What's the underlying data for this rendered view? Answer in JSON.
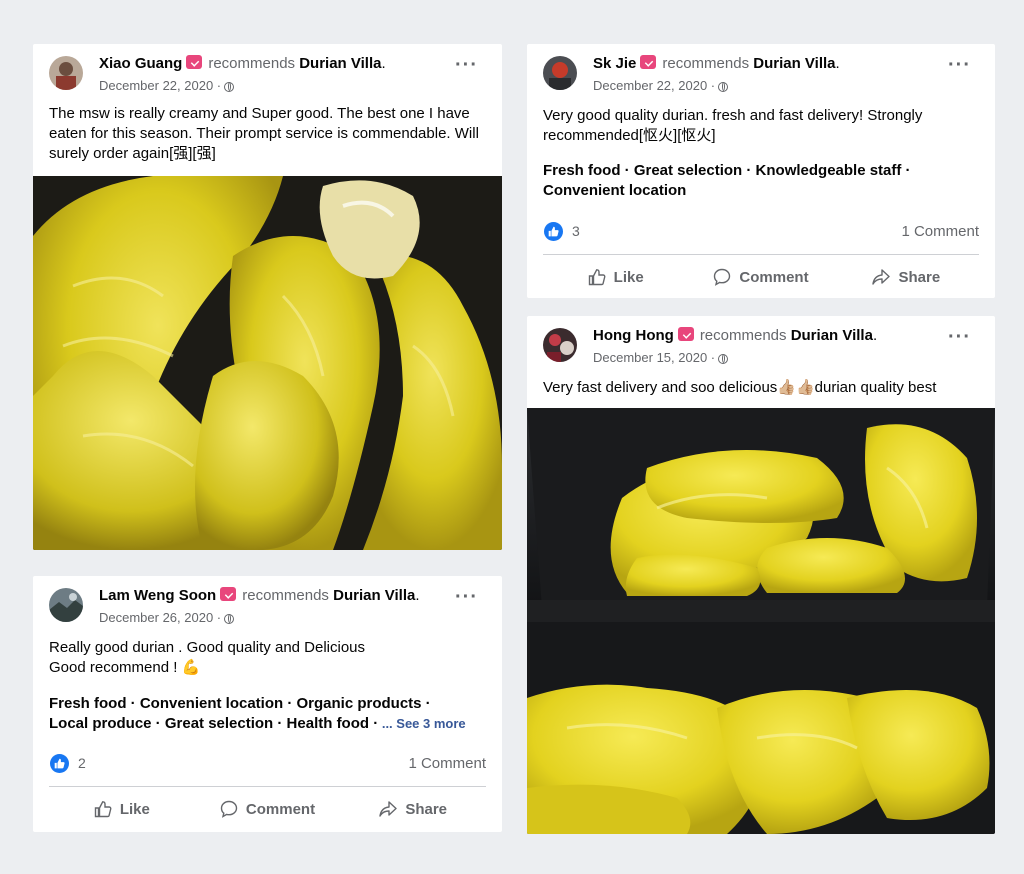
{
  "posts": [
    {
      "name": "Xiao Guang",
      "recommends": "recommends",
      "page": "Durian Villa",
      "date": "December 22, 2020 ·",
      "text": "The msw is really creamy and Super good. The best one I have eaten for this season. Their prompt service is commendable. Will surely order again[强][强]"
    },
    {
      "name": "Lam Weng Soon",
      "recommends": "recommends",
      "page": "Durian Villa",
      "date": "December 26, 2020 ·",
      "text_line1": "Really good durian . Good quality and Delicious",
      "text_line2": "Good recommend ! 💪",
      "tags_line1": "Fresh food · Convenient location · Organic products ·",
      "tags_line2": "Local produce · Great selection · Health food ·",
      "see_more": " ... See 3 more",
      "likes": "2",
      "comments": "1 Comment",
      "like_label": "Like",
      "comment_label": "Comment",
      "share_label": "Share"
    },
    {
      "name": "Sk Jie",
      "recommends": "recommends",
      "page": "Durian Villa",
      "date": "December 22, 2020 ·",
      "text": "Very good quality durian. fresh and fast delivery! Strongly recommended[怄火][怄火]",
      "tags": "Fresh food · Great selection · Knowledgeable staff · Convenient location",
      "likes": "3",
      "comments": "1 Comment",
      "like_label": "Like",
      "comment_label": "Comment",
      "share_label": "Share"
    },
    {
      "name": "Hong Hong",
      "recommends": "recommends",
      "page": "Durian Villa",
      "date": "December 15, 2020 ·",
      "text": "Very fast delivery and soo delicious👍🏼👍🏼durian quality best"
    }
  ],
  "colors": {
    "background": "#eceef1",
    "like_blue": "#1877f2",
    "badge_pink": "#e8467c",
    "durian_yellow": "#e3d21f"
  },
  "icons": [
    "like-icon",
    "comment-icon",
    "share-icon",
    "globe-icon",
    "more-options-icon",
    "recommend-badge-icon"
  ]
}
